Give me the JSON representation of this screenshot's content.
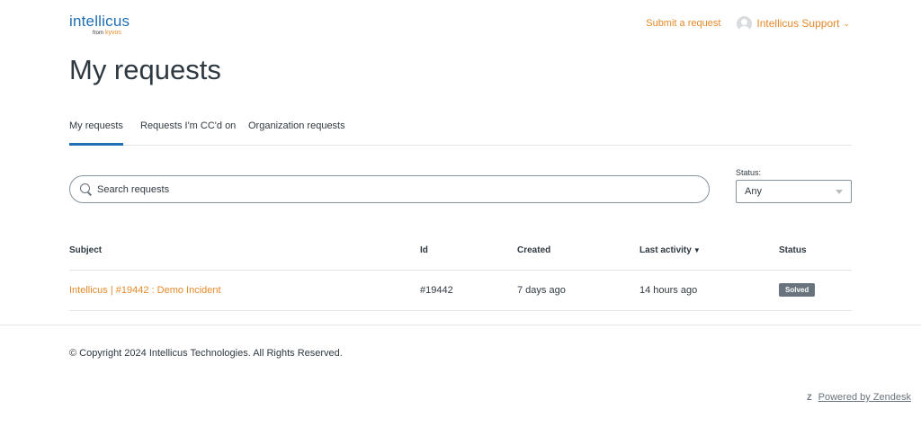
{
  "header": {
    "logo_text": "intellicus",
    "logo_sub_prefix": "from",
    "logo_sub_brand": "kyvos",
    "submit_request": "Submit a request",
    "user_name": "Intellicus Support",
    "user_chevron": "⌄"
  },
  "page": {
    "title": "My requests"
  },
  "tabs": [
    {
      "label": "My requests"
    },
    {
      "label": "Requests I'm CC'd on"
    },
    {
      "label": "Organization requests"
    }
  ],
  "search": {
    "placeholder": "Search requests"
  },
  "status_filter": {
    "label": "Status:",
    "selected": "Any"
  },
  "table": {
    "columns": [
      "Subject",
      "Id",
      "Created",
      "Last activity",
      "Status"
    ],
    "sort_indicator": "▼",
    "rows": [
      {
        "subject": "Intellicus | #19442 : Demo Incident",
        "id": "#19442",
        "created": "7 days ago",
        "last_activity": "14 hours ago",
        "status": "Solved"
      }
    ]
  },
  "footer": {
    "copyright": "© Copyright 2024 Intellicus Technologies. All Rights Reserved.",
    "powered_by": "Powered by Zendesk",
    "zendesk_icon": "zendesk-icon"
  },
  "colors": {
    "accent_orange": "#e4892a",
    "brand_blue": "#1f6fb5",
    "badge_gray": "#68737d"
  }
}
